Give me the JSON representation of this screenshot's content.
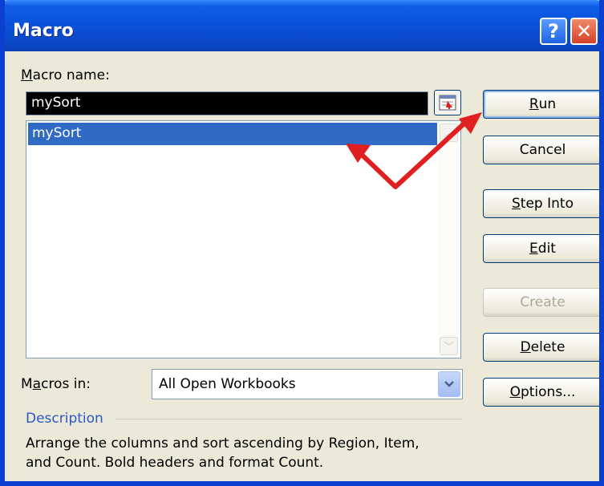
{
  "window": {
    "title": "Macro"
  },
  "macro_name": {
    "label_accesskey": "M",
    "label_rest": "acro name:",
    "value": "mySort"
  },
  "macro_list": {
    "items": [
      "mySort"
    ],
    "selected": "mySort"
  },
  "buttons": {
    "run": {
      "pre": "",
      "accesskey": "R",
      "post": "un",
      "enabled": true
    },
    "cancel": {
      "label": "Cancel",
      "enabled": true
    },
    "step_into": {
      "pre": "",
      "accesskey": "S",
      "post": "tep Into",
      "enabled": true
    },
    "edit": {
      "pre": "",
      "accesskey": "E",
      "post": "dit",
      "enabled": true
    },
    "create": {
      "label": "Create",
      "enabled": false
    },
    "delete": {
      "pre": "",
      "accesskey": "D",
      "post": "elete",
      "enabled": true
    },
    "options": {
      "pre": "",
      "accesskey": "O",
      "post": "ptions...",
      "enabled": true
    }
  },
  "macros_in": {
    "label_pre": "M",
    "label_accesskey": "a",
    "label_post": "cros in:",
    "selected": "All Open Workbooks"
  },
  "description": {
    "title": "Description",
    "line1": "Arrange the columns and sort ascending by Region, Item,",
    "line2": "and Count. Bold headers and format Count."
  },
  "colors": {
    "title_bar": "#0a4fd6",
    "selection": "#316ac5",
    "annotation_arrow": "#e02020"
  },
  "icons": {
    "help": "help-icon",
    "close": "close-icon",
    "range_selector": "range-selector-icon",
    "dropdown": "chevron-down-icon",
    "annotation": "red-arrow-icon"
  }
}
